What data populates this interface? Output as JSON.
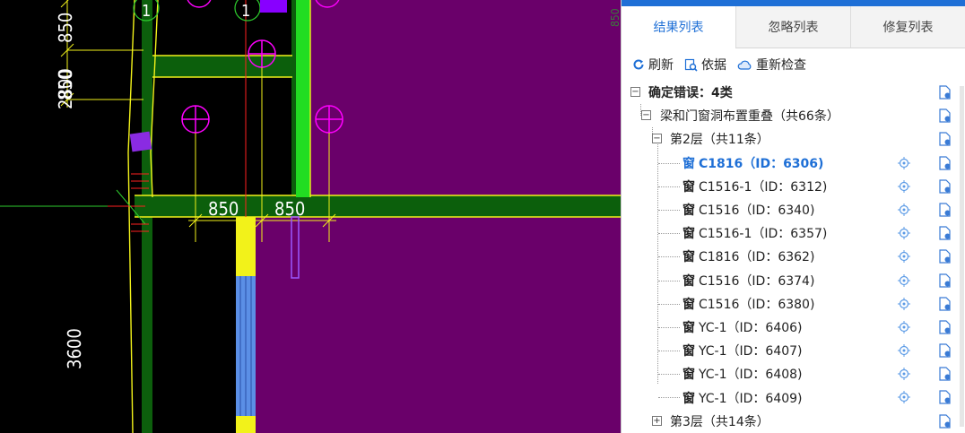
{
  "cad": {
    "dims": {
      "left_top": "850",
      "left_mid_a": "850",
      "left_mid_b": "2800",
      "bottom_a": "850",
      "bottom_b": "850",
      "left_low": "3600"
    },
    "axis_markers": [
      "1",
      "1"
    ],
    "colors": {
      "background": "#000000",
      "room_fill": "#6a006a",
      "wall_green": "#0c5f0c",
      "bright_green": "#22dd22",
      "yellow": "#f2f21a",
      "window_blue": "#5b8fe6",
      "magenta": "#ff00ff",
      "purple": "#8800ff",
      "red": "#ff2020"
    }
  },
  "panel": {
    "tabs": [
      "结果列表",
      "忽略列表",
      "修复列表"
    ],
    "active_tab": 0,
    "toolbar": {
      "refresh": "刷新",
      "basis": "依据",
      "recheck": "重新检查"
    },
    "tree": {
      "root": "确定错误：4类",
      "group": "梁和门窗洞布置重叠（共66条）",
      "floor2": "第2层（共11条）",
      "floor3": "第3层（共14条）",
      "window_glyph": "窗",
      "items": [
        "C1816（ID：6306)",
        "C1516-1（ID：6312)",
        "C1516（ID：6340)",
        "C1516-1（ID：6357)",
        "C1816（ID：6362)",
        "C1516（ID：6374)",
        "C1516（ID：6380)",
        "YC-1（ID：6406)",
        "YC-1（ID：6407)",
        "YC-1（ID：6408)",
        "YC-1（ID：6409)"
      ],
      "selected_index": 0
    }
  }
}
